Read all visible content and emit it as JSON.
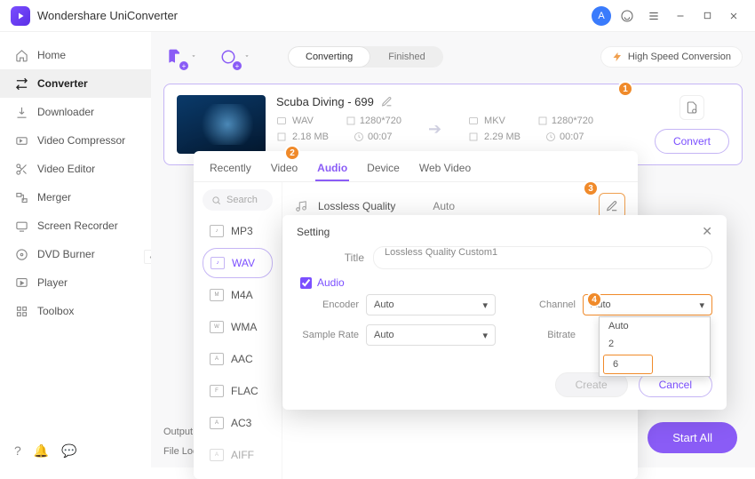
{
  "brand": "Wondershare UniConverter",
  "titlebar": {
    "avatar_initial": "A"
  },
  "sidebar": {
    "items": [
      {
        "label": "Home"
      },
      {
        "label": "Converter"
      },
      {
        "label": "Downloader"
      },
      {
        "label": "Video Compressor"
      },
      {
        "label": "Video Editor"
      },
      {
        "label": "Merger"
      },
      {
        "label": "Screen Recorder"
      },
      {
        "label": "DVD Burner"
      },
      {
        "label": "Player"
      },
      {
        "label": "Toolbox"
      }
    ]
  },
  "topbar": {
    "segment": {
      "converting": "Converting",
      "finished": "Finished"
    },
    "high_speed": "High Speed Conversion"
  },
  "card": {
    "title": "Scuba Diving - 699",
    "src": {
      "fmt": "WAV",
      "res": "1280*720",
      "size": "2.18 MB",
      "dur": "00:07"
    },
    "dst": {
      "fmt": "MKV",
      "res": "1280*720",
      "size": "2.29 MB",
      "dur": "00:07"
    },
    "convert_label": "Convert"
  },
  "format_panel": {
    "tabs": [
      "Recently",
      "Video",
      "Audio",
      "Device",
      "Web Video"
    ],
    "active_tab": "Audio",
    "search_placeholder": "Search",
    "formats": [
      "MP3",
      "WAV",
      "M4A",
      "WMA",
      "AAC",
      "FLAC",
      "AC3",
      "AIFF"
    ],
    "active_format": "WAV",
    "preset": {
      "name": "Lossless Quality",
      "value": "Auto"
    }
  },
  "settings": {
    "header": "Setting",
    "title_label": "Title",
    "title_value": "Lossless Quality Custom1",
    "audio_label": "Audio",
    "encoder_label": "Encoder",
    "encoder_value": "Auto",
    "sample_label": "Sample Rate",
    "sample_value": "Auto",
    "channel_label": "Channel",
    "channel_value": "Auto",
    "bitrate_label": "Bitrate",
    "channel_options": [
      "Auto",
      "2",
      "6"
    ],
    "create_label": "Create",
    "cancel_label": "Cancel"
  },
  "callouts": {
    "c1": "1",
    "c2": "2",
    "c3": "3",
    "c4": "4"
  },
  "bottom": {
    "output": "Output",
    "fileloc": "File Loc"
  },
  "start_all": "Start All"
}
